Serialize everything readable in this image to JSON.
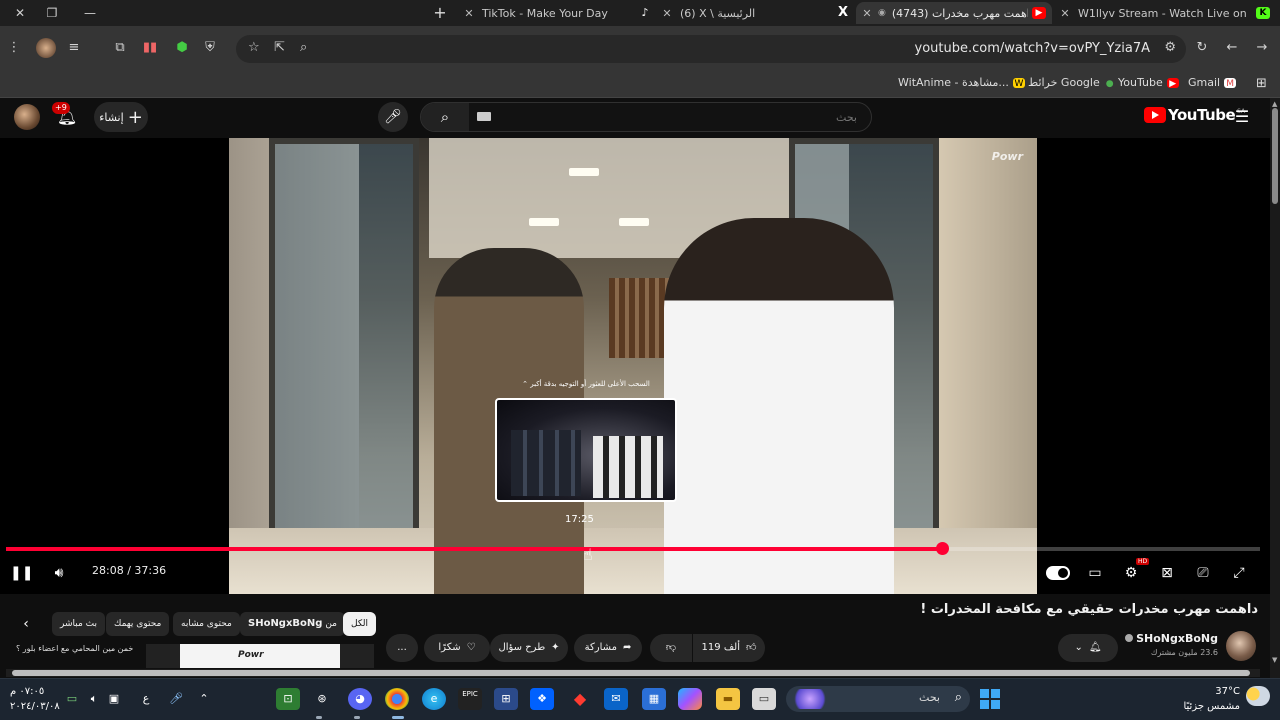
{
  "browser": {
    "tabs": [
      {
        "title": "W1llyv Stream - Watch Live on",
        "favicon": "kick",
        "active": false
      },
      {
        "title": "(4743) داهمت مهرب مخدرات",
        "favicon": "youtube",
        "active": true
      },
      {
        "title": "(6) X \\ الرئيسية",
        "favicon": "x",
        "active": false
      },
      {
        "title": "TikTok - Make Your Day",
        "favicon": "tiktok",
        "active": false
      }
    ],
    "url": "youtube.com/watch?v=ovPY_Yzia7A",
    "bookmarks": [
      {
        "label": "Gmail",
        "icon": "gmail-icon"
      },
      {
        "label": "YouTube",
        "icon": "youtube-icon"
      },
      {
        "label": "خرائط Google",
        "icon": "maps-icon"
      },
      {
        "label": "WitAnime - مشاهدة...",
        "icon": "witanime-icon"
      }
    ]
  },
  "youtube": {
    "logo_text": "YouTube",
    "region": "SA",
    "search_placeholder": "بحث",
    "create_label": "إنشاء",
    "notifications_badge": "+9"
  },
  "player": {
    "watermark": "Powr",
    "preview_caption": "السحب الأعلى للعثور أو التوجيه بدقة أكبر",
    "preview_time": "17:25",
    "current_time": "28:08",
    "duration": "37:36",
    "time_display": "28:08 / 37:36",
    "progress": 0.7465,
    "hover_position": 0.4633,
    "hd_badge": "HD"
  },
  "video": {
    "title": "داهمت مهرب مخدرات حقيقي مع مكافحة المخدرات !",
    "channel": "SHoNgxBoNg",
    "subscribers": "23.6 مليون مشترك",
    "likes": "119 ألف",
    "share_label": "مشاركة",
    "ask_label": "طرح سؤال",
    "thanks_label": "شكرًا",
    "more_label": "..."
  },
  "chips": {
    "all": "الكل",
    "from_channel_prefix": "من",
    "from_channel": "SHoNgxBoNg",
    "similar": "محتوى مشابه",
    "for_you": "محتوى يهمك",
    "live": "بث مباشر"
  },
  "recommendation": {
    "text": "خمن مين المحامي مع اعضاء بلور ؟",
    "thumb_text": "Powr"
  },
  "taskbar": {
    "search_label": "بحث",
    "weather_temp": "37°C",
    "weather_desc": "مشمس جزئيًا",
    "time": "٠٧:٠٥ م",
    "date": "٢٠٢٤/٠٣/٠٨",
    "lang": "ع"
  }
}
